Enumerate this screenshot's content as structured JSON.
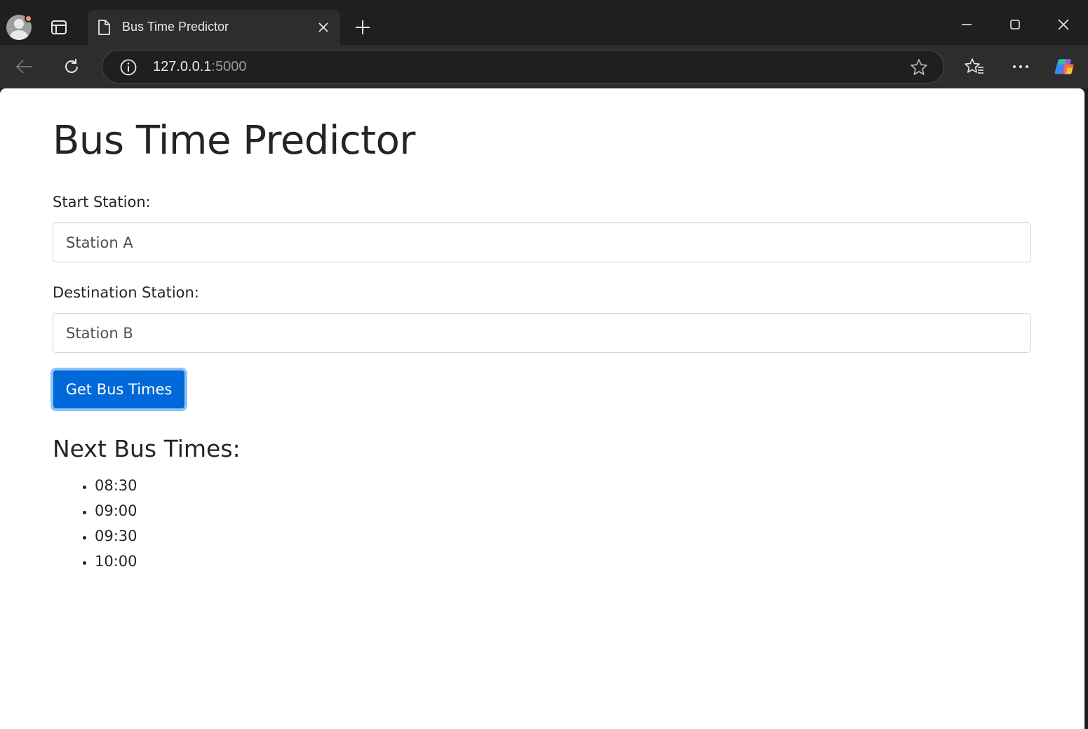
{
  "browser": {
    "tab": {
      "title": "Bus Time Predictor"
    },
    "address_bar": {
      "host": "127.0.0.1",
      "port": ":5000"
    },
    "accent_color": "#0069d9"
  },
  "page": {
    "title": "Bus Time Predictor",
    "form": {
      "start_label": "Start Station:",
      "start_value": "Station A",
      "destination_label": "Destination Station:",
      "destination_value": "Station B",
      "submit_label": "Get Bus Times"
    },
    "results": {
      "heading": "Next Bus Times:",
      "times": [
        "08:30",
        "09:00",
        "09:30",
        "10:00"
      ]
    }
  }
}
